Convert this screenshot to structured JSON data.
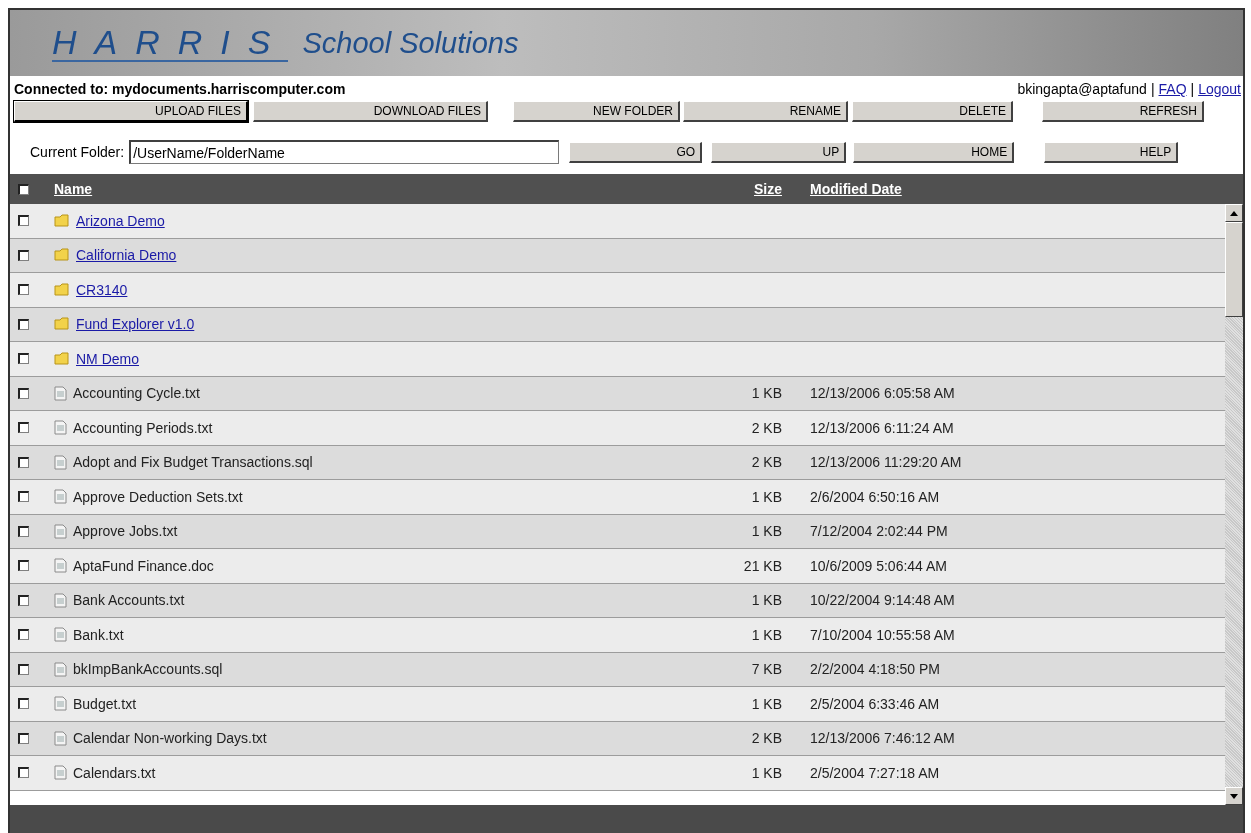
{
  "header": {
    "logo": "HARRIS",
    "subtitle": "School Solutions"
  },
  "connection": {
    "label": "Connected to: mydocuments.harriscomputer.com",
    "user": "bkingapta@aptafund",
    "separator": "|",
    "links": [
      "FAQ",
      "Logout"
    ]
  },
  "actions": [
    {
      "label": "UPLOAD FILES",
      "focused": true
    },
    {
      "label": "DOWNLOAD FILES",
      "focused": false
    },
    {
      "label": "NEW FOLDER",
      "focused": false
    },
    {
      "label": "RENAME",
      "focused": false
    },
    {
      "label": "DELETE",
      "focused": false
    },
    {
      "label": "REFRESH",
      "focused": false
    }
  ],
  "folder_bar": {
    "label": "Current Folder:",
    "value": "/UserName/FolderName",
    "buttons": [
      {
        "label": "GO",
        "focused": false
      },
      {
        "label": "UP",
        "focused": false
      },
      {
        "label": "HOME",
        "focused": false
      },
      {
        "label": "HELP",
        "focused": false
      }
    ]
  },
  "table": {
    "select_all": {
      "checked": false
    },
    "columns": [
      "Name",
      "Size",
      "Modified Date"
    ],
    "rows": [
      {
        "kind": "folder",
        "name": "Arizona Demo",
        "checked": false
      },
      {
        "kind": "folder",
        "name": "California Demo",
        "checked": false
      },
      {
        "kind": "folder",
        "name": "CR3140",
        "checked": false
      },
      {
        "kind": "folder",
        "name": "Fund Explorer v1.0",
        "checked": false
      },
      {
        "kind": "folder",
        "name": "NM Demo",
        "checked": false
      },
      {
        "kind": "file",
        "name": "Accounting Cycle.txt",
        "size": "1 KB",
        "modified": "12/13/2006 6:05:58 AM",
        "checked": false
      },
      {
        "kind": "file",
        "name": "Accounting Periods.txt",
        "size": "2 KB",
        "modified": "12/13/2006 6:11:24 AM",
        "checked": false
      },
      {
        "kind": "file",
        "name": "Adopt and Fix Budget Transactions.sql",
        "size": "2 KB",
        "modified": "12/13/2006 11:29:20 AM",
        "checked": false
      },
      {
        "kind": "file",
        "name": "Approve Deduction Sets.txt",
        "size": "1 KB",
        "modified": "2/6/2004 6:50:16 AM",
        "checked": false
      },
      {
        "kind": "file",
        "name": "Approve Jobs.txt",
        "size": "1 KB",
        "modified": "7/12/2004 2:02:44 PM",
        "checked": false
      },
      {
        "kind": "file",
        "name": "AptaFund Finance.doc",
        "size": "21 KB",
        "modified": "10/6/2009 5:06:44 AM",
        "checked": false
      },
      {
        "kind": "file",
        "name": "Bank Accounts.txt",
        "size": "1 KB",
        "modified": "10/22/2004 9:14:48 AM",
        "checked": false
      },
      {
        "kind": "file",
        "name": "Bank.txt",
        "size": "1 KB",
        "modified": "7/10/2004 10:55:58 AM",
        "checked": false
      },
      {
        "kind": "file",
        "name": "bkImpBankAccounts.sql",
        "size": "7 KB",
        "modified": "2/2/2004 4:18:50 PM",
        "checked": false
      },
      {
        "kind": "file",
        "name": "Budget.txt",
        "size": "1 KB",
        "modified": "2/5/2004 6:33:46 AM",
        "checked": false
      },
      {
        "kind": "file",
        "name": "Calendar Non-working Days.txt",
        "size": "2 KB",
        "modified": "12/13/2006 7:46:12 AM",
        "checked": false
      },
      {
        "kind": "file",
        "name": "Calendars.txt",
        "size": "1 KB",
        "modified": "2/5/2004 7:27:18 AM",
        "checked": false
      }
    ]
  }
}
